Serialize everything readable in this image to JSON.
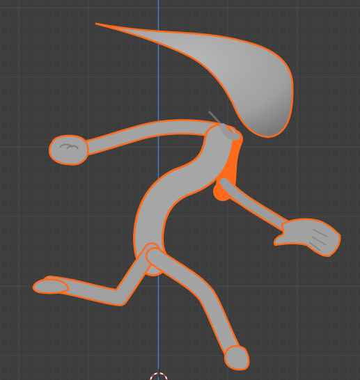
{
  "viewport": {
    "app": "3D viewport",
    "object": {
      "name": "character-mesh",
      "selected": true,
      "pose": "running"
    },
    "overlays": {
      "grid": true,
      "z_axis_line": true,
      "origin_cursor": true
    },
    "colors": {
      "background": "#3d3d3d",
      "grid_minor": "#444444",
      "grid_major": "#525252",
      "z_axis": "#3e7fc1",
      "mesh_fill": "#a2a2a2",
      "mesh_shadow": "#6f6f6f",
      "selection_outline": "#ff6a1a",
      "cursor_red": "#e03a3a",
      "cursor_white": "#ffffff"
    }
  }
}
